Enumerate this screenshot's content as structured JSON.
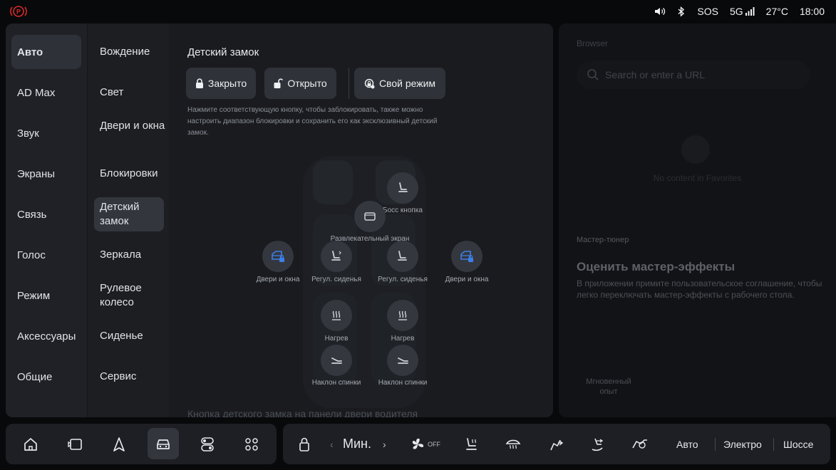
{
  "status": {
    "sos": "SOS",
    "network": "5G",
    "temperature": "27°C",
    "time": "18:00"
  },
  "nav_primary": [
    "Авто",
    "AD Max",
    "Звук",
    "Экраны",
    "Связь",
    "Голос",
    "Режим",
    "Аксессуары",
    "Общие"
  ],
  "nav_secondary": [
    "Вождение",
    "Свет",
    "Двери и окна",
    "Блокировки",
    "Детский замок",
    "Зеркала",
    "Рулевое колесо",
    "Сиденье",
    "Сервис"
  ],
  "content": {
    "title": "Детский замок",
    "btn_locked": "Закрыто",
    "btn_open": "Открыто",
    "btn_custom": "Свой режим",
    "description": "Нажмите соответствующую кнопку, чтобы заблокировать, также можно настроить диапазон блокировки и сохранить его как эксклюзивный детский замок.",
    "bottom_text": "Кнопка детского замка на панели двери водителя"
  },
  "controls": {
    "boss_button": "Босс кнопка",
    "entertainment_screen": "Развлекательный экран",
    "doors_windows_left": "Двери и окна",
    "doors_windows_right": "Двери и окна",
    "seat_adjust_left": "Регул. сиденья",
    "seat_adjust_right": "Регул. сиденья",
    "heating_left": "Нагрев",
    "heating_right": "Нагрев",
    "recline_left": "Наклон спинки",
    "recline_right": "Наклон спинки"
  },
  "right_panel": {
    "browser_label": "Browser",
    "search_placeholder": "Search or enter a URL",
    "no_content": "No content in Favorites",
    "tuner_label": "Мастер-тюнер",
    "tuner_title": "Оценить мастер-эффекты",
    "tuner_desc": "В приложении примите пользовательское соглашение, чтобы легко переключать мастер-эффекты с рабочего стола.",
    "instant_experience": "Мгновенный опыт"
  },
  "dock": {
    "fan_speed": "Мин.",
    "fan_state": "OFF",
    "mode_auto": "Авто",
    "mode_electric": "Электро",
    "mode_highway": "Шоссе"
  },
  "colors": {
    "accent_blue": "#3d7fe6",
    "park_red": "#d92b2b"
  }
}
